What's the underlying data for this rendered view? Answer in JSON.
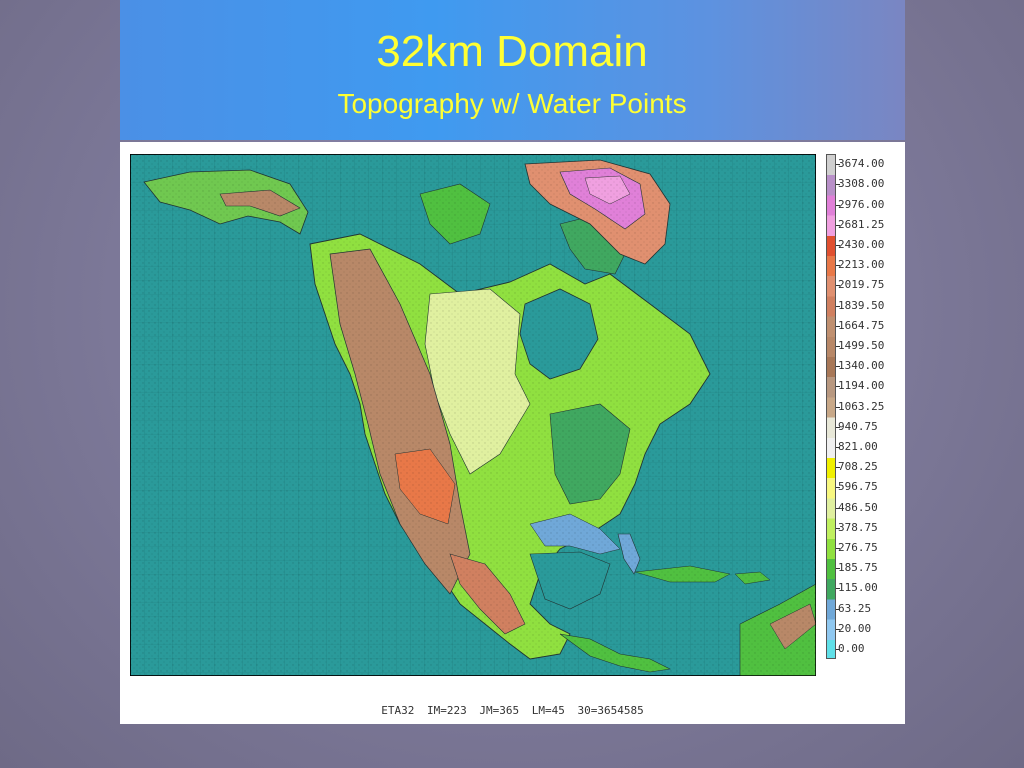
{
  "slide": {
    "title": "32km Domain",
    "subtitle": "Topography w/ Water Points",
    "footer": "ETA32   IM=223   JM=365   LM=45   30=3654585"
  },
  "legend": {
    "levels": [
      {
        "label": "3674.00",
        "color": "#cfcfcf"
      },
      {
        "label": "3308.00",
        "color": "#b890c8"
      },
      {
        "label": "2976.00",
        "color": "#e080d8"
      },
      {
        "label": "2681.25",
        "color": "#f0a0e0"
      },
      {
        "label": "2430.00",
        "color": "#e05030"
      },
      {
        "label": "2213.00",
        "color": "#e87848"
      },
      {
        "label": "2019.75",
        "color": "#e09070"
      },
      {
        "label": "1839.50",
        "color": "#d08060"
      },
      {
        "label": "1664.75",
        "color": "#c09070"
      },
      {
        "label": "1499.50",
        "color": "#b88868"
      },
      {
        "label": "1340.00",
        "color": "#a87858"
      },
      {
        "label": "1194.00",
        "color": "#b89880"
      },
      {
        "label": "1063.25",
        "color": "#c8a888"
      },
      {
        "label": "940.75",
        "color": "#e8e8d8"
      },
      {
        "label": "821.00",
        "color": "#f0f0f0"
      },
      {
        "label": "708.25",
        "color": "#f0f000"
      },
      {
        "label": "596.75",
        "color": "#f8f880"
      },
      {
        "label": "486.50",
        "color": "#e0f0a0"
      },
      {
        "label": "378.75",
        "color": "#c0f060"
      },
      {
        "label": "276.75",
        "color": "#90e040"
      },
      {
        "label": "185.75",
        "color": "#50c040"
      },
      {
        "label": "115.00",
        "color": "#40a860"
      },
      {
        "label": "63.25",
        "color": "#70a8d8"
      },
      {
        "label": "20.00",
        "color": "#90c8f0"
      },
      {
        "label": "0.00",
        "color": "#60e0e8"
      }
    ]
  },
  "colors": {
    "ocean": "#2a9a9a",
    "title_text": "#ffff33"
  }
}
